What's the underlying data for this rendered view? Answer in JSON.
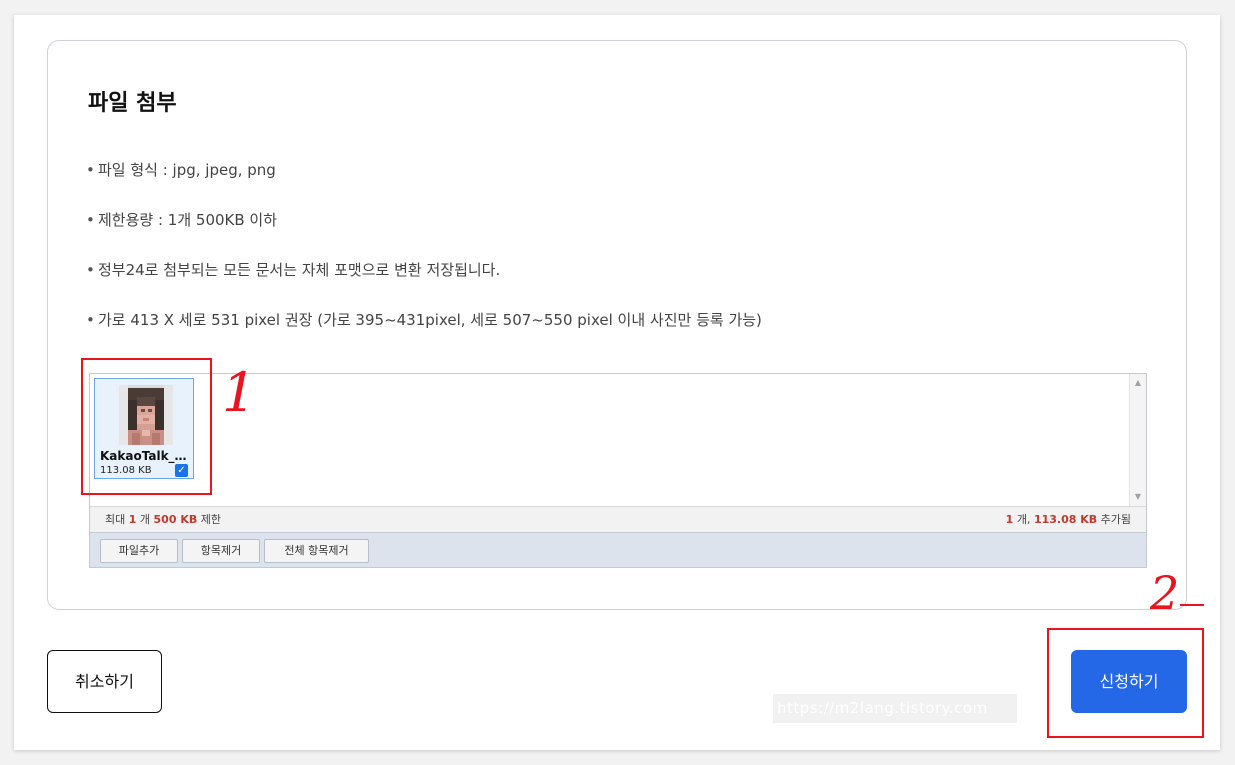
{
  "card": {
    "title": "파일 첨부",
    "bullets": [
      "파일 형식 : jpg, jpeg, png",
      "제한용량 : 1개 500KB 이하",
      "정부24로 첨부되는 모든 문서는 자체 포맷으로 변환 저장됩니다.",
      "가로 413 X 세로 531 pixel 권장 (가로 395~431pixel, 세로 507~550 pixel 이내 사진만 등록 가능)"
    ]
  },
  "uploader": {
    "file": {
      "name": "KakaoTalk_…",
      "size": "113.08 KB",
      "checked": true,
      "icon": "photo-thumbnail-icon"
    },
    "status_left": {
      "prefix": "최대",
      "count": "1",
      "unit": "개",
      "limit": "500 KB",
      "suffix": "제한"
    },
    "status_right": {
      "count": "1",
      "unit": "개,",
      "total": "113.08 KB",
      "suffix": "추가됨"
    },
    "buttons": {
      "add": "파일추가",
      "remove": "항목제거",
      "remove_all": "전체 항목제거"
    }
  },
  "actions": {
    "cancel": "취소하기",
    "submit": "신청하기"
  },
  "watermark": "https://m2lang.tistory.com",
  "annotations": {
    "label_1": "1",
    "label_2": "2"
  },
  "colors": {
    "accent": "#2468e8",
    "highlight": "#c0392b",
    "annotation": "#e8141e"
  }
}
